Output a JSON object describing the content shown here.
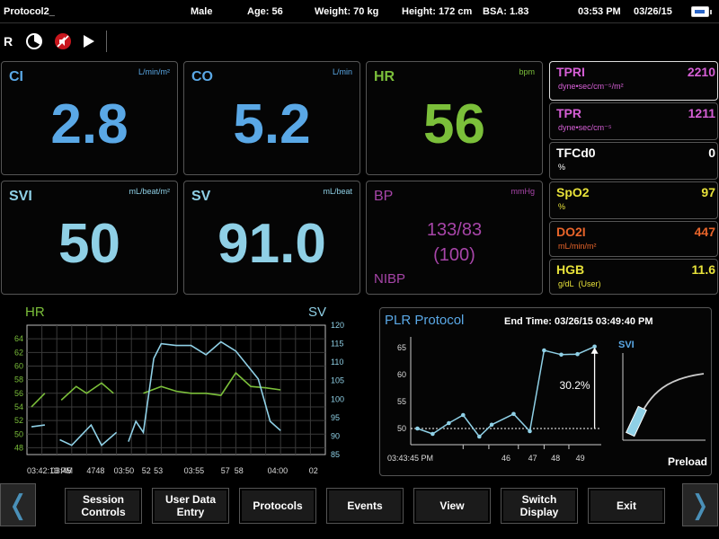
{
  "header": {
    "protocol": "Protocol2_",
    "sex": "Male",
    "age": "Age: 56",
    "weight": "Weight: 70 kg",
    "height": "Height: 172 cm",
    "bsa": "BSA: 1.83",
    "time": "03:53 PM",
    "date": "03/26/15"
  },
  "toolbar": {
    "r_label": "R"
  },
  "tiles": {
    "ci": {
      "label": "CI",
      "unit": "L/min/m²",
      "value": "2.8"
    },
    "co": {
      "label": "CO",
      "unit": "L/min",
      "value": "5.2"
    },
    "hr": {
      "label": "HR",
      "unit": "bpm",
      "value": "56"
    },
    "svi": {
      "label": "SVI",
      "unit": "mL/beat/m²",
      "value": "50"
    },
    "sv": {
      "label": "SV",
      "unit": "mL/beat",
      "value": "91.0"
    },
    "bp": {
      "label": "BP",
      "unit": "mmHg",
      "value": "133/83",
      "mean": "(100)",
      "source": "NIBP"
    }
  },
  "side": {
    "tpri": {
      "label": "TPRI",
      "value": "2210",
      "unit": "dyne•sec/cm⁻⁵/m²"
    },
    "tpr": {
      "label": "TPR",
      "value": "1211",
      "unit": "dyne•sec/cm⁻⁵"
    },
    "tfc": {
      "label": "TFCd0",
      "value": "0",
      "unit": "%"
    },
    "spo2": {
      "label": "SpO2",
      "value": "97",
      "unit": "%"
    },
    "do2i": {
      "label": "DO2I",
      "value": "447",
      "unit": "mL/min/m²"
    },
    "hgb": {
      "label": "HGB",
      "value": "11.6",
      "unit": "g/dL",
      "note": "(User)"
    }
  },
  "colors": {
    "blue": "#5aa8e6",
    "green": "#7bbf3a",
    "teal": "#8fd0e6",
    "purple": "#a745a8",
    "pink": "#d65fd6",
    "yellow": "#e8e23a",
    "orange": "#e8642a"
  },
  "chart_data": [
    {
      "type": "line",
      "title_left": "HR",
      "title_right": "SV",
      "x_ticks": [
        "03:42:13 PM",
        "03:45",
        "47",
        "48",
        "03:50",
        "52",
        "53",
        "03:55",
        "57",
        "58",
        "04:00",
        "02"
      ],
      "y_left_ticks": [
        48,
        50,
        52,
        54,
        56,
        58,
        60,
        62,
        64
      ],
      "y_right_ticks": [
        85,
        90,
        95,
        100,
        105,
        110,
        115,
        120
      ],
      "y_left_range": [
        47,
        66
      ],
      "y_right_range": [
        85,
        120
      ],
      "x_range": [
        0,
        20
      ],
      "series": [
        {
          "axis": "left",
          "segments": [
            [
              [
                0.3,
                54
              ],
              [
                1.2,
                56
              ]
            ],
            [
              [
                2.3,
                55
              ],
              [
                3.3,
                57
              ],
              [
                4.0,
                56
              ],
              [
                5.0,
                57.5
              ],
              [
                5.8,
                56
              ]
            ],
            [
              [
                7.8,
                56
              ],
              [
                9.0,
                57
              ],
              [
                10.0,
                56.3
              ],
              [
                11.0,
                56
              ],
              [
                12.0,
                56
              ],
              [
                13.0,
                55.7
              ],
              [
                14.0,
                59
              ],
              [
                15.0,
                57
              ],
              [
                16.0,
                56.8
              ],
              [
                17.0,
                56.5
              ]
            ]
          ]
        },
        {
          "axis": "right",
          "segments": [
            [
              [
                0.3,
                92.5
              ],
              [
                1.2,
                93
              ]
            ],
            [
              [
                2.2,
                89
              ],
              [
                3.0,
                87.5
              ],
              [
                4.3,
                93
              ],
              [
                5.0,
                87.5
              ],
              [
                6.0,
                91
              ]
            ],
            [
              [
                6.8,
                88.5
              ],
              [
                7.3,
                94
              ],
              [
                7.8,
                91
              ],
              [
                8.5,
                111
              ],
              [
                9.0,
                115
              ],
              [
                10.0,
                114.5
              ],
              [
                11.0,
                114.5
              ],
              [
                12.0,
                112
              ],
              [
                13.0,
                115.5
              ],
              [
                14.0,
                113
              ],
              [
                15.5,
                105.5
              ],
              [
                16.3,
                94
              ],
              [
                17.0,
                91.5
              ]
            ]
          ]
        }
      ]
    },
    {
      "type": "line",
      "title": "PLR Protocol",
      "end_time": "End Time: 03/26/15 03:49:40 PM",
      "series_label": "SVI",
      "x_ticks": [
        "03:43:45 PM",
        "46",
        "47",
        "48",
        "49"
      ],
      "y_ticks": [
        50,
        55,
        60,
        65
      ],
      "y_range": [
        47,
        66
      ],
      "x_range": [
        0,
        20
      ],
      "baseline": 50,
      "change_label": "30.2%",
      "values": [
        [
          0.7,
          50
        ],
        [
          2.3,
          49
        ],
        [
          4.0,
          51
        ],
        [
          5.5,
          52.5
        ],
        [
          7.2,
          48.5
        ],
        [
          8.5,
          50.7
        ],
        [
          10.8,
          52.7
        ],
        [
          12.5,
          49.5
        ],
        [
          14.0,
          64.5
        ],
        [
          15.8,
          63.7
        ],
        [
          17.5,
          63.8
        ],
        [
          19.3,
          65.2
        ]
      ],
      "curve_label": "Preload"
    }
  ],
  "buttons": {
    "session": "Session Controls",
    "user_data": "User Data Entry",
    "protocols": "Protocols",
    "events": "Events",
    "view": "View",
    "switch": "Switch Display",
    "exit": "Exit",
    "prev": "❬",
    "next": "❭"
  }
}
